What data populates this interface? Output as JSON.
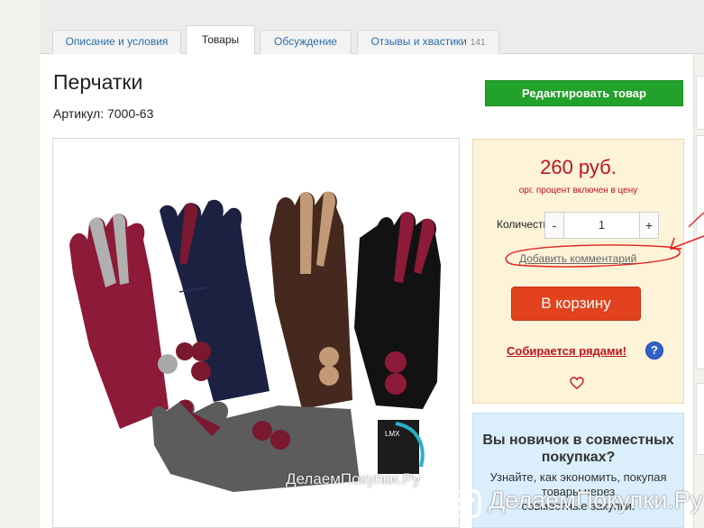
{
  "tabs": [
    {
      "label": "Описание и условия"
    },
    {
      "label": "Товары"
    },
    {
      "label": "Обсуждение"
    },
    {
      "label": "Отзывы и хвастики",
      "count": "141"
    }
  ],
  "product": {
    "title": "Перчатки",
    "sku": "Артикул: 7000-63"
  },
  "edit_button": "Редактировать товар",
  "photo": {
    "watermark": "ДелаемПокупки.Ру"
  },
  "buy": {
    "price": "260 руб.",
    "price_note": "орг. процент включен в цену",
    "qty_label": "Количество:",
    "qty_minus": "-",
    "qty_value": "1",
    "qty_plus": "+",
    "comment_link": "Добавить комментарий",
    "cart_button": "В корзину",
    "rows_link": "Собирается рядами!",
    "help": "?"
  },
  "newbie": {
    "title": "Вы новичок в совместных покупках?",
    "text": "Узнайте, как экономить, покупая товары через",
    "more": "совместные закупки."
  },
  "site_watermark": "ДелаемПокупки.Ру",
  "colors": {
    "edit": "#22a12b",
    "price": "#c0141d",
    "cart": "#e2421e",
    "buy_bg": "#fdf3d9",
    "newbie_bg": "#dbeefb",
    "annotation": "#e32020"
  }
}
